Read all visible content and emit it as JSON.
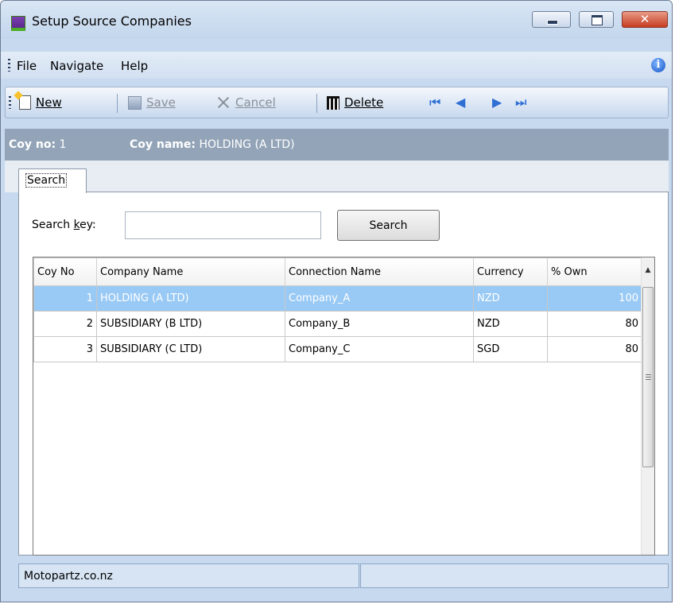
{
  "window": {
    "title": "Setup Source Companies"
  },
  "menu": {
    "items": [
      "File",
      "Navigate",
      "Help"
    ]
  },
  "toolbar": {
    "new_label": "New",
    "save_label": "Save",
    "cancel_label": "Cancel",
    "delete_label": "Delete"
  },
  "header": {
    "coy_no_label": "Coy no:",
    "coy_no_value": "1",
    "coy_name_label": "Coy name:",
    "coy_name_value": "HOLDING (A LTD)"
  },
  "tabs": [
    {
      "label": "Search",
      "active": true
    }
  ],
  "search": {
    "label_pre": "Search ",
    "label_accel": "k",
    "label_post": "ey:",
    "value": "",
    "button_label": "Search"
  },
  "grid": {
    "columns": [
      "Coy No",
      "Company Name",
      "Connection Name",
      "Currency",
      "% Own"
    ],
    "rows": [
      {
        "coy_no": "1",
        "company_name": "HOLDING (A LTD)",
        "connection_name": "Company_A",
        "currency": "NZD",
        "own": "100",
        "selected": true
      },
      {
        "coy_no": "2",
        "company_name": "SUBSIDIARY (B LTD)",
        "connection_name": "Company_B",
        "currency": "NZD",
        "own": "80",
        "selected": false
      },
      {
        "coy_no": "3",
        "company_name": "SUBSIDIARY (C LTD)",
        "connection_name": "Company_C",
        "currency": "SGD",
        "own": "80",
        "selected": false
      }
    ]
  },
  "status": {
    "text": "Motopartz.co.nz"
  },
  "colors": {
    "selection": "#99c9f5",
    "header_band": "#93a4b8",
    "chrome": "#c6d9ee"
  }
}
